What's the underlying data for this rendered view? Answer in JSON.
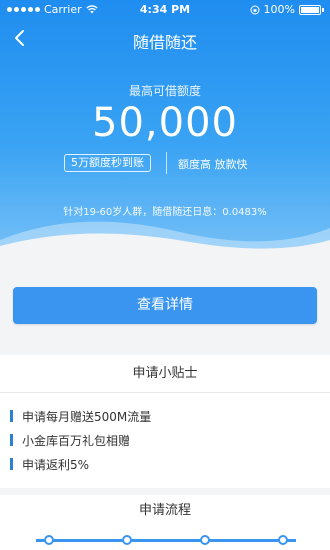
{
  "status_bar": {
    "carrier": "Carrier",
    "time": "4:34 PM",
    "battery": "100%"
  },
  "nav": {
    "title": "随借随还"
  },
  "hero": {
    "quota_label": "最高可借额度",
    "quota_amount": "50,000",
    "feature_pill": "5万额度秒到账",
    "feature_text": "额度高  放款快",
    "note": "针对19-60岁人群，随借随还日息：0.0483%"
  },
  "cta": {
    "label": "查看详情"
  },
  "tips": {
    "title": "申请小贴士",
    "items": [
      "申请每月赠送500M流量",
      "小金库百万礼包相赠",
      "申请返利5%"
    ]
  },
  "process": {
    "title": "申请流程"
  },
  "colors": {
    "primary": "#1f8df0",
    "button": "#3a95f0",
    "accent_bar": "#2d7fd8"
  }
}
